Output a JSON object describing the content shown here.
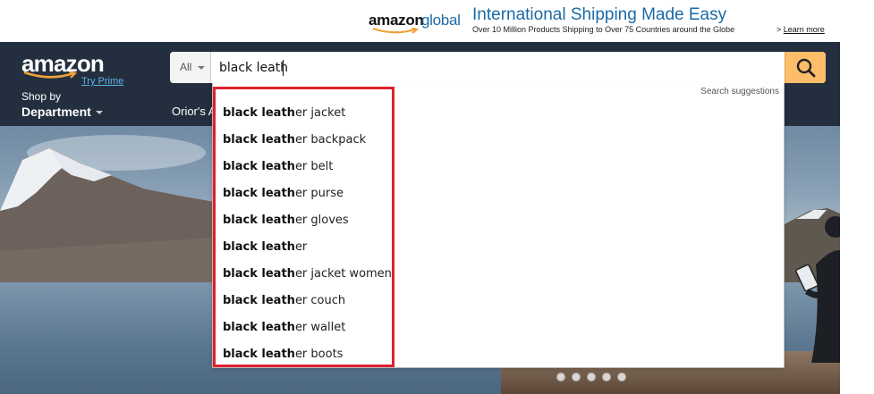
{
  "promo": {
    "logo_amazon": "amazon",
    "logo_global": "global",
    "headline": "International Shipping Made Easy",
    "subline": "Over 10 Million Products Shipping to Over 75 Countries around the Globe",
    "learn_prefix": ">",
    "learn_more": "Learn more"
  },
  "header": {
    "logo": "amazon",
    "try_prime": "Try Prime",
    "shop_by": "Shop by",
    "department": "Department",
    "nav_link": "Orior's A"
  },
  "search": {
    "category": "All",
    "value": "black leath",
    "button_icon": "search-icon"
  },
  "suggestions": {
    "header": "Search suggestions",
    "typed": "black leath",
    "items": [
      {
        "typed": "black leath",
        "rest": "er jacket"
      },
      {
        "typed": "black leath",
        "rest": "er backpack"
      },
      {
        "typed": "black leath",
        "rest": "er belt"
      },
      {
        "typed": "black leath",
        "rest": "er purse"
      },
      {
        "typed": "black leath",
        "rest": "er gloves"
      },
      {
        "typed": "black leath",
        "rest": "er"
      },
      {
        "typed": "black leath",
        "rest": "er jacket women"
      },
      {
        "typed": "black leath",
        "rest": "er couch"
      },
      {
        "typed": "black leath",
        "rest": "er wallet"
      },
      {
        "typed": "black leath",
        "rest": "er boots"
      }
    ]
  },
  "colors": {
    "header_bg": "#232f3e",
    "search_button": "#febd69",
    "highlight": "#e0202e",
    "link_blue": "#1b6aa5"
  }
}
